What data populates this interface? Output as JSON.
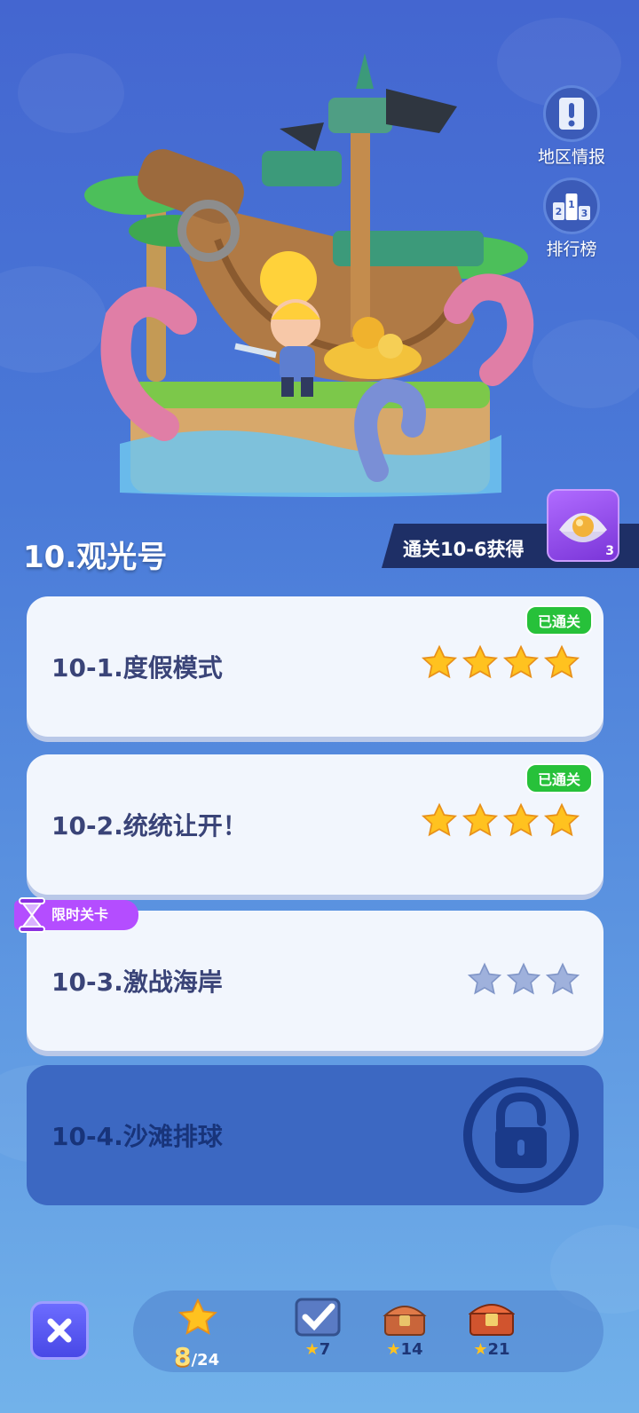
{
  "side_buttons": [
    {
      "label": "地区情报",
      "icon": "scroll-exclamation-icon"
    },
    {
      "label": "排行榜",
      "icon": "podium-icon"
    }
  ],
  "level": {
    "title": "10.观光号",
    "reward_text": "通关10-6获得",
    "reward_count": "3",
    "reward_icon": "pearl-shell-icon"
  },
  "stages": [
    {
      "name": "10-1.度假模式",
      "badge": "已通关",
      "stars_earned": 4,
      "stars_total": 4,
      "state": "cleared"
    },
    {
      "name": "10-2.统统让开！",
      "badge": "已通关",
      "stars_earned": 4,
      "stars_total": 4,
      "state": "cleared"
    },
    {
      "name": "10-3.激战海岸",
      "tag": "限时关卡",
      "stars_earned": 0,
      "stars_total": 3,
      "state": "open"
    },
    {
      "name": "10-4.沙滩排球",
      "state": "locked"
    }
  ],
  "bottom": {
    "star_current": "8",
    "star_total": "/24",
    "milestones": [
      {
        "icon": "checkmark-icon",
        "value": "7"
      },
      {
        "icon": "treasure-chest-icon",
        "value": "14"
      },
      {
        "icon": "treasure-chest-large-icon",
        "value": "21"
      }
    ]
  },
  "colors": {
    "star_gold": "#ffc21f",
    "star_empty": "#9fb1dc",
    "cleared_badge": "#27c13a",
    "timed_tag": "#b44dff",
    "reward_purple": "#8b45e6"
  }
}
